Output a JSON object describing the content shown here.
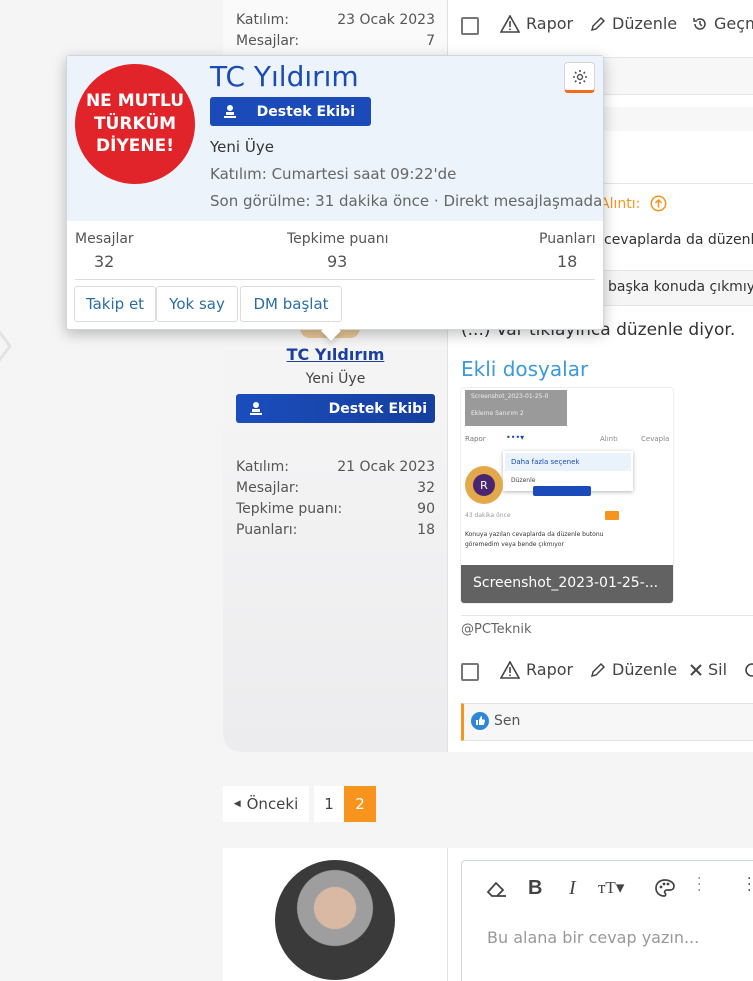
{
  "top_post": {
    "joined_label": "Katılım:",
    "joined_value": "23 Ocak 2023",
    "messages_label": "Mesajlar:",
    "messages_value": "7",
    "actions": {
      "report": "Rapor",
      "edit": "Düzenle",
      "history": "Geçmiş"
    }
  },
  "popup": {
    "avatar_text": [
      "NE MUTLU",
      "TÜRKÜM",
      "DİYENE!"
    ],
    "username": "TC Yıldırım",
    "badge": "Destek Ekibi",
    "title": "Yeni Üye",
    "joined": "Katılım: Cumartesi saat 09:22'de",
    "last_seen": "Son görülme: 31 dakika önce · Direkt mesajlaşmada",
    "stats": [
      {
        "label": "Mesajlar",
        "value": "32"
      },
      {
        "label": "Tepkime puanı",
        "value": "93"
      },
      {
        "label": "Puanları",
        "value": "18"
      }
    ],
    "buttons": {
      "follow": "Takip et",
      "ignore": "Yok say",
      "dm": "DM başlat"
    }
  },
  "post": {
    "quote_label": "Alıntı:",
    "quote_line1": "cevaplarda da düzenle",
    "quote_line2": "başka konuda çıkmıy",
    "body_text": "(...) Var tıklayınca düzenle diyor.",
    "attachments_heading": "Ekli dosyalar",
    "attachment_name": "Screenshot_2023-01-25-...",
    "attachment_preview": {
      "top1": "Screenshot_2023-01-25-0",
      "top2": "Ekleme Sanırım 2",
      "report": "Rapor",
      "more_options": "Daha fazla seçenek",
      "edit": "Düzenle",
      "quote": "Alıntı",
      "reply": "Cevapla",
      "time": "43 dakika önce",
      "line1": "Konuya yazılan cevaplarda da düzenle butonu",
      "line2": "göremedim veya bende çıkmıyor"
    },
    "signature": "@PCTeknik",
    "actions": {
      "report": "Rapor",
      "edit": "Düzenle",
      "delete": "Sil"
    },
    "reaction": "Sen"
  },
  "author": {
    "name": "TC Yıldırım",
    "title": "Yeni Üye",
    "badge": "Destek Ekibi",
    "stats": [
      {
        "label": "Katılım:",
        "value": "21 Ocak 2023"
      },
      {
        "label": "Mesajlar:",
        "value": "32"
      },
      {
        "label": "Tepkime puanı:",
        "value": "90"
      },
      {
        "label": "Puanları:",
        "value": "18"
      }
    ]
  },
  "pagination": {
    "prev": "Önceki",
    "pages": [
      "1",
      "2"
    ],
    "current": "2"
  },
  "editor": {
    "placeholder": "Bu alana bir cevap yazın..."
  },
  "colors": {
    "accent_orange": "#f7941e",
    "link_blue": "#2b6ea5",
    "badge_blue": "#1a4bb8",
    "heading_blue": "#3b9ad9"
  }
}
